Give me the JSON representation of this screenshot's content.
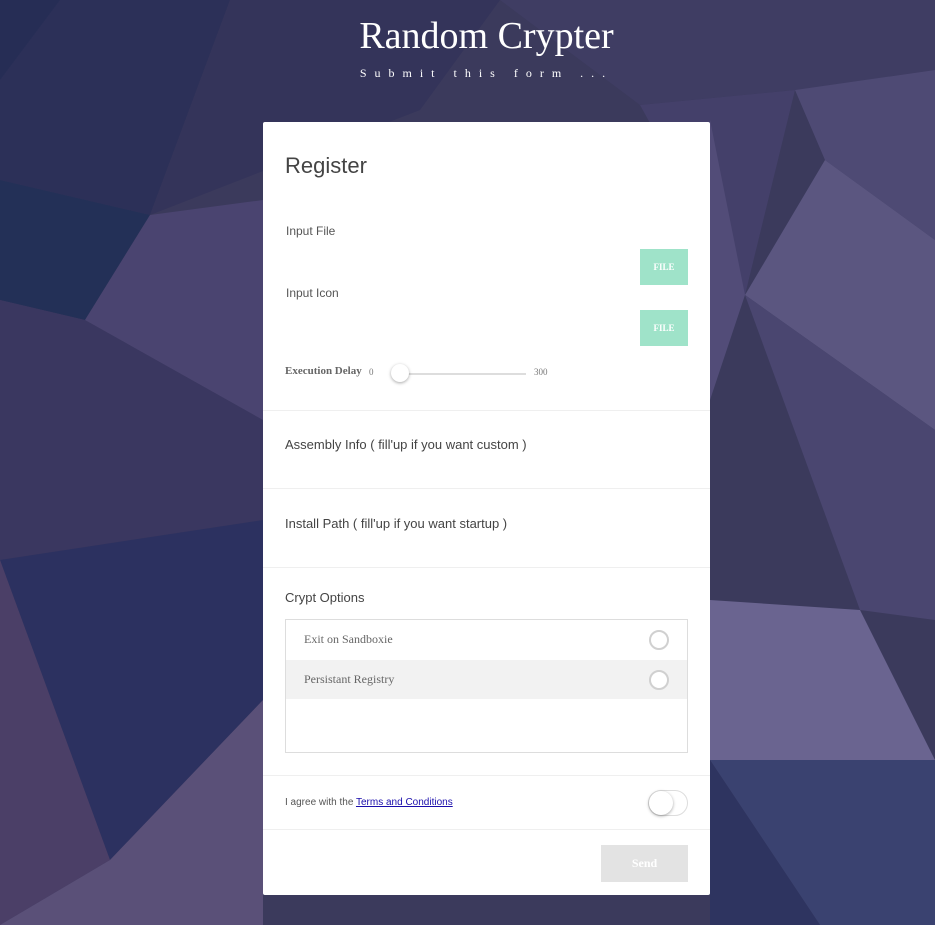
{
  "header": {
    "title": "Random Crypter",
    "subtitle": "Submit this form ..."
  },
  "form": {
    "title": "Register",
    "input_file_label": "Input File",
    "input_icon_label": "Input Icon",
    "file_button_label": "FILE",
    "execution_delay": {
      "label": "Execution Delay",
      "min": "0",
      "max": "300",
      "value": 0
    },
    "assembly_info": "Assembly Info ( fill'up if you want custom )",
    "install_path": "Install Path ( fill'up if you want startup )",
    "crypt_options": {
      "title": "Crypt Options",
      "items": [
        {
          "label": "Exit on Sandboxie",
          "checked": false
        },
        {
          "label": "Persistant Registry",
          "checked": false
        }
      ]
    },
    "agree_prefix": "I agree with the ",
    "agree_link": "Terms and Conditions",
    "agree_on": false,
    "send_label": "Send"
  },
  "colors": {
    "background": "#3b3a5c",
    "file_button": "#9fe3c9",
    "send_button": "#e3e3e3",
    "link": "#1a0dab"
  }
}
